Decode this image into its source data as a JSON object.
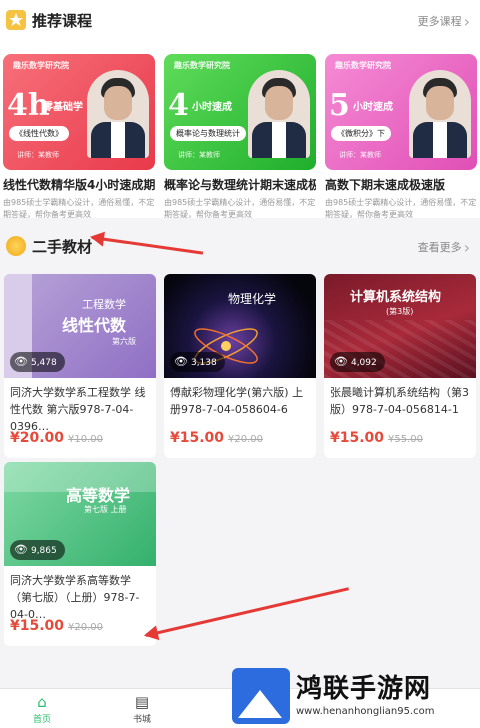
{
  "recommended": {
    "title": "推荐课程",
    "more": "更多课程",
    "courses": [
      {
        "brand": "趣乐数学研究院",
        "big": "4h",
        "sub": "零基础学",
        "pill": "《线性代数》",
        "teacher": "讲师：某教师",
        "name": "线性代数精华版4小时速成期末…",
        "desc": "由985硕士学霸精心设计，通俗易懂，不定期答疑，帮你备考更高效",
        "color_from": "#f7707a",
        "color_to": "#e8394a"
      },
      {
        "brand": "趣乐数学研究院",
        "big": "4",
        "sub": "小时速成",
        "pill": "概率论与数理统计",
        "teacher": "讲师：某教师",
        "name": "概率论与数理统计期末速成极…",
        "desc": "由985硕士学霸精心设计，通俗易懂，不定期答疑，帮你备考更高效",
        "color_from": "#5fdc5a",
        "color_to": "#1fae2c"
      },
      {
        "brand": "趣乐数学研究院",
        "big": "5",
        "sub": "小时速成",
        "pill": "《微积分》下",
        "teacher": "讲师：某教师",
        "name": "高数下期末速成极速版",
        "desc": "由985硕士学霸精心设计，通俗易懂，不定期答疑，帮你备考更高效",
        "color_from": "#f58bd4",
        "color_to": "#e04fb6"
      }
    ]
  },
  "textbooks": {
    "title": "二手教材",
    "more": "查看更多",
    "books": [
      {
        "cover_title": "工程数学",
        "cover_sub": "线性代数",
        "cover_edition": "第六版",
        "views": "5,478",
        "title": "同济大学数学系工程数学 线性代数 第六版978-7-04-0396…",
        "price": "¥20.00",
        "old_price": "¥10.00"
      },
      {
        "cover_title": "物理化学",
        "cover_sub": "",
        "cover_edition": "",
        "views": "3,138",
        "title": "傅献彩物理化学(第六版) 上册978-7-04-058604-6",
        "price": "¥15.00",
        "old_price": "¥20.00"
      },
      {
        "cover_title": "计算机系统结构",
        "cover_sub": "",
        "cover_edition": "(第3版)",
        "views": "4,092",
        "title": "张晨曦计算机系统结构（第3版）978-7-04-056814-1",
        "price": "¥15.00",
        "old_price": "¥55.00"
      },
      {
        "cover_title": "高等数学",
        "cover_sub": "",
        "cover_edition": "第七版 上册",
        "views": "9,865",
        "title": "同济大学数学系高等数学（第七版）（上册）978-7-04-0…",
        "price": "¥15.00",
        "old_price": "¥20.00"
      }
    ]
  },
  "tabbar": {
    "tabs": [
      {
        "label": "首页",
        "icon": "home-icon",
        "active": true
      },
      {
        "label": "书城",
        "icon": "bookstore-icon",
        "active": false
      }
    ]
  },
  "watermark": {
    "text": "鸿联手游网",
    "url": "www.henanhonglian95.com"
  },
  "colors": {
    "accent": "#2bbd6e",
    "price": "#e64a3b",
    "annotation_arrow": "#e53935"
  }
}
